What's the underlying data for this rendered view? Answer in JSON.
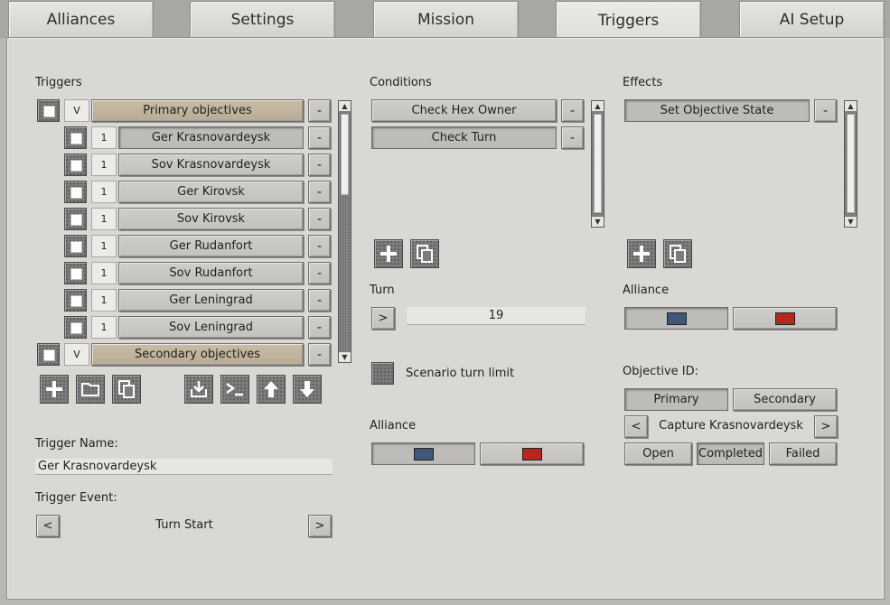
{
  "tabs": [
    "Alliances",
    "Settings",
    "Mission",
    "Triggers",
    "AI Setup"
  ],
  "active_tab": "Triggers",
  "triggers": {
    "label": "Triggers",
    "groups": [
      {
        "toggle": "V",
        "name": "Primary objectives",
        "items": [
          {
            "num": "1",
            "name": "Ger Krasnovardeysk"
          },
          {
            "num": "1",
            "name": "Sov Krasnovardeysk"
          },
          {
            "num": "1",
            "name": "Ger Kirovsk"
          },
          {
            "num": "1",
            "name": "Sov Kirovsk"
          },
          {
            "num": "1",
            "name": "Ger Rudanfort"
          },
          {
            "num": "1",
            "name": "Sov Rudanfort"
          },
          {
            "num": "1",
            "name": "Ger Leningrad"
          },
          {
            "num": "1",
            "name": "Sov Leningrad"
          }
        ]
      },
      {
        "toggle": "V",
        "name": "Secondary objectives",
        "items": []
      }
    ],
    "minus": "-",
    "trigger_name_label": "Trigger Name:",
    "trigger_name_value": "Ger Krasnovardeysk",
    "trigger_event_label": "Trigger Event:",
    "trigger_event_value": "Turn Start",
    "prev": "<",
    "next": ">"
  },
  "conditions": {
    "label": "Conditions",
    "items": [
      "Check Hex Owner",
      "Check Turn"
    ],
    "minus": "-",
    "turn_label": "Turn",
    "turn_op": ">",
    "turn_value": "19",
    "scenario_limit_label": "Scenario turn limit",
    "alliance_label": "Alliance",
    "alliance_colors": [
      "#3f5878",
      "#b8261e"
    ]
  },
  "effects": {
    "label": "Effects",
    "items": [
      "Set Objective State"
    ],
    "minus": "-",
    "alliance_label": "Alliance",
    "alliance_colors": [
      "#3f5878",
      "#b8261e"
    ],
    "objective_id_label": "Objective ID:",
    "objective_types": [
      "Primary",
      "Secondary"
    ],
    "objective_name": "Capture Krasnovardeysk",
    "prev": "<",
    "next": ">",
    "states": [
      "Open",
      "Completed",
      "Failed"
    ],
    "selected_state": "Completed"
  }
}
